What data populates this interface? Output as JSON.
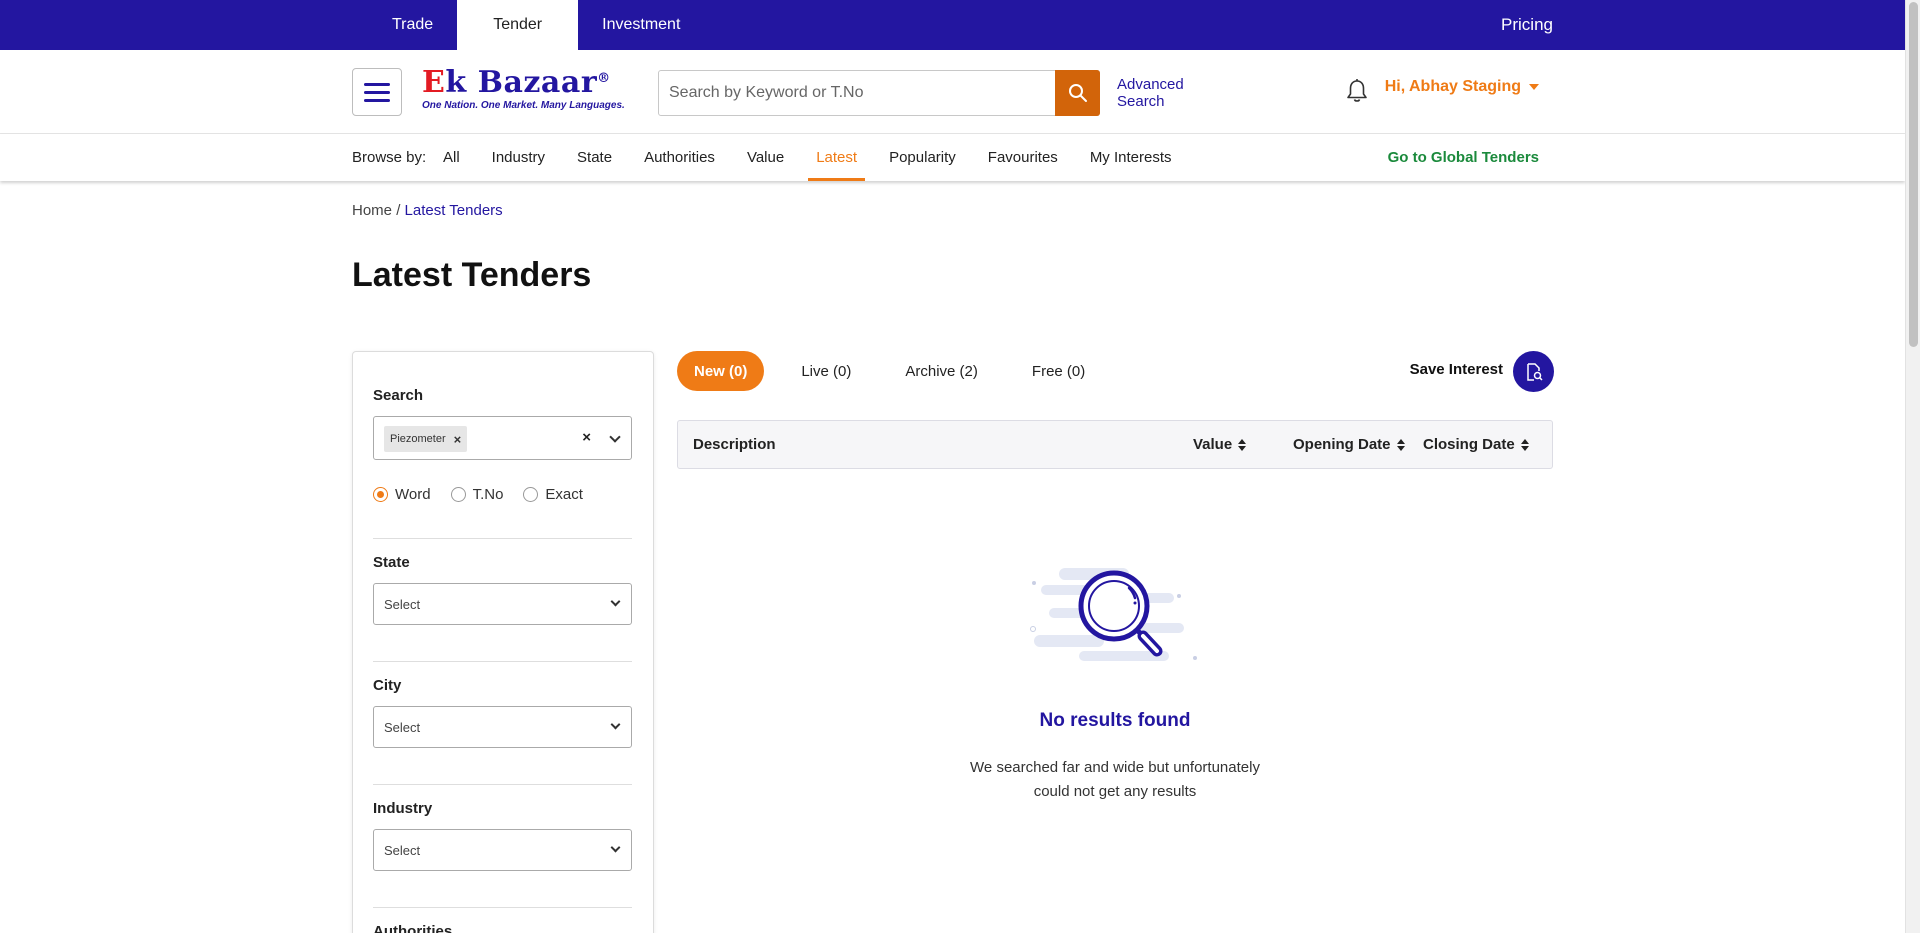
{
  "topnav": {
    "tabs": [
      {
        "label": "Trade"
      },
      {
        "label": "Tender"
      },
      {
        "label": "Investment"
      }
    ],
    "active": "Tender",
    "pricing": "Pricing"
  },
  "header": {
    "logo_text": "Ek Bazaar",
    "logo_tagline": "One Nation. One Market. Many Languages.",
    "search_placeholder": "Search by Keyword or T.No",
    "advanced_search": [
      "Advanced",
      "Search"
    ],
    "user_greeting": "Hi, Abhay Staging"
  },
  "browse": {
    "label": "Browse by:",
    "items": [
      "All",
      "Industry",
      "State",
      "Authorities",
      "Value",
      "Latest",
      "Popularity",
      "Favourites",
      "My Interests"
    ],
    "active": "Latest",
    "global_link": "Go to Global Tenders"
  },
  "breadcrumb": {
    "home": "Home",
    "separator": "/",
    "current": "Latest Tenders"
  },
  "page_title": "Latest Tenders",
  "filters": {
    "search_label": "Search",
    "search_chip": "Piezometer",
    "radio_options": [
      "Word",
      "T.No",
      "Exact"
    ],
    "radio_selected": "Word",
    "state_label": "State",
    "state_value": "Select",
    "city_label": "City",
    "city_value": "Select",
    "industry_label": "Industry",
    "industry_value": "Select",
    "authorities_label": "Authorities"
  },
  "results": {
    "tabs": [
      "New (0)",
      "Live (0)",
      "Archive (2)",
      "Free (0)"
    ],
    "active_tab": "New (0)",
    "save_interest": "Save Interest",
    "columns": [
      "Description",
      "Value",
      "Opening Date",
      "Closing Date"
    ],
    "empty_title": "No results found",
    "empty_lines": [
      "We searched far and wide but unfortunately",
      "could not get any results"
    ]
  },
  "colors": {
    "brand": "#2316a0",
    "accent": "#ef7b16",
    "search_button": "#d2640a",
    "global_link": "#1b8a3c"
  }
}
